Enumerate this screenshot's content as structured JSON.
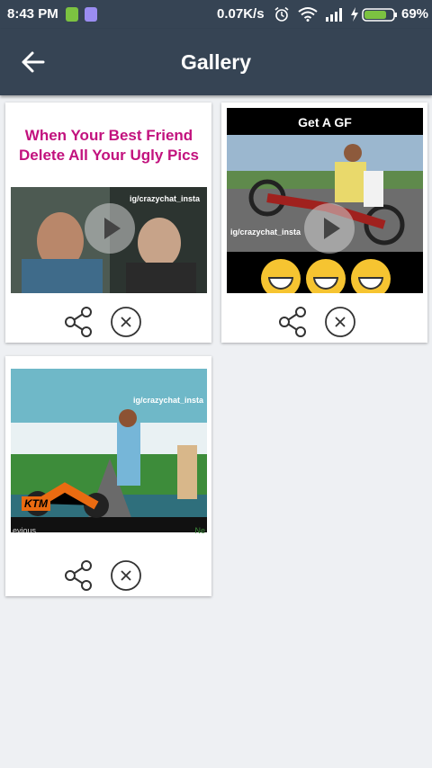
{
  "status": {
    "time": "8:43 PM",
    "net_speed": "0.07K/s",
    "battery": "69%"
  },
  "appbar": {
    "title": "Gallery"
  },
  "items": [
    {
      "caption_line1": "When Your Best Friend",
      "caption_line2": "Delete All Your Ugly Pics",
      "watermark": "ig/crazychat_insta"
    },
    {
      "caption": "Get A GF",
      "watermark": "ig/crazychat_insta"
    },
    {
      "watermark": "ig/crazychat_insta",
      "brand": "KTM",
      "prev_label": "evious",
      "next_label": "Ne"
    }
  ],
  "colors": {
    "bar": "#364454",
    "background": "#eef0f3",
    "caption": "#c2127e"
  }
}
